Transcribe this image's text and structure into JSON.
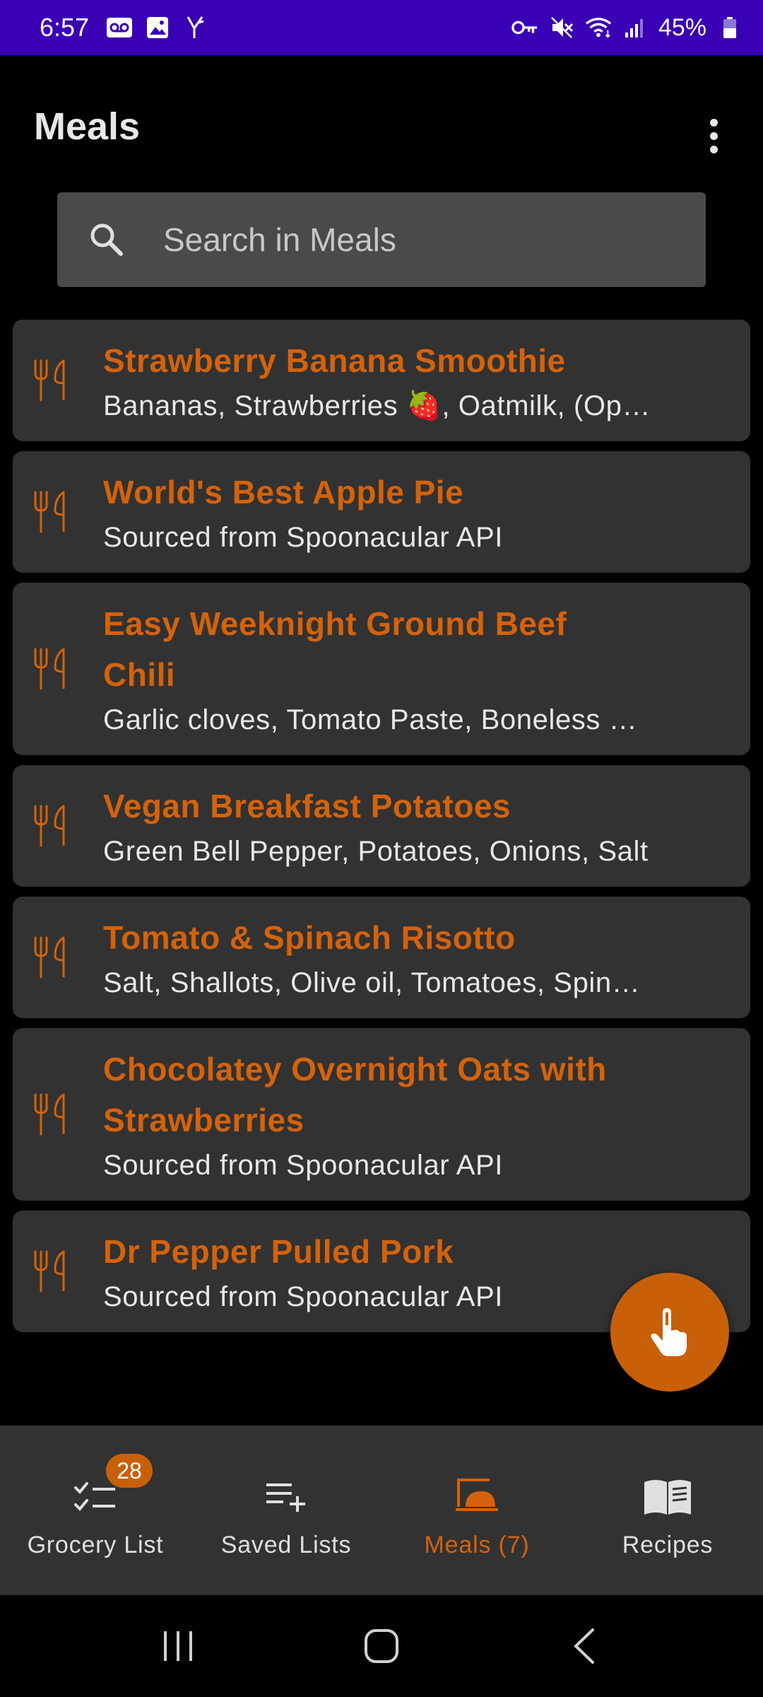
{
  "status_bar": {
    "time": "6:57",
    "battery": "45%",
    "left_icons": [
      "voicemail-icon",
      "image-icon",
      "yammer-icon"
    ],
    "right_icons": [
      "vpn-key-icon",
      "mute-icon",
      "wifi-icon",
      "signal-icon",
      "battery-icon"
    ]
  },
  "header": {
    "title": "Meals"
  },
  "search": {
    "placeholder": "Search in Meals",
    "value": ""
  },
  "meals": [
    {
      "title": "Strawberry Banana Smoothie",
      "subtitle": "Bananas, Strawberries 🍓, Oatmilk, (Optional) Oats"
    },
    {
      "title": "World's Best Apple Pie",
      "subtitle": "Sourced from Spoonacular API"
    },
    {
      "title": "Easy Weeknight Ground Beef Chili",
      "subtitle": "Garlic cloves, Tomato Paste, Boneless Beef"
    },
    {
      "title": "Vegan Breakfast Potatoes",
      "subtitle": "Green Bell Pepper, Potatoes, Onions, Salt"
    },
    {
      "title": "Tomato & Spinach Risotto",
      "subtitle": "Salt, Shallots, Olive oil, Tomatoes, Spinach"
    },
    {
      "title": "Chocolatey Overnight Oats with Strawberries",
      "subtitle": "Sourced from Spoonacular API"
    },
    {
      "title": "Dr Pepper Pulled Pork",
      "subtitle": "Sourced from Spoonacular API"
    }
  ],
  "bottom_nav": {
    "items": [
      {
        "label": "Grocery List",
        "icon": "checklist-icon",
        "badge": "28"
      },
      {
        "label": "Saved Lists",
        "icon": "playlist-add-icon"
      },
      {
        "label": "Meals (7)",
        "icon": "meal-icon",
        "active": true
      },
      {
        "label": "Recipes",
        "icon": "book-icon"
      }
    ]
  },
  "colors": {
    "accent": "#d4620c",
    "status_bar": "#3a00b5",
    "card": "#323232",
    "background": "#000000"
  }
}
